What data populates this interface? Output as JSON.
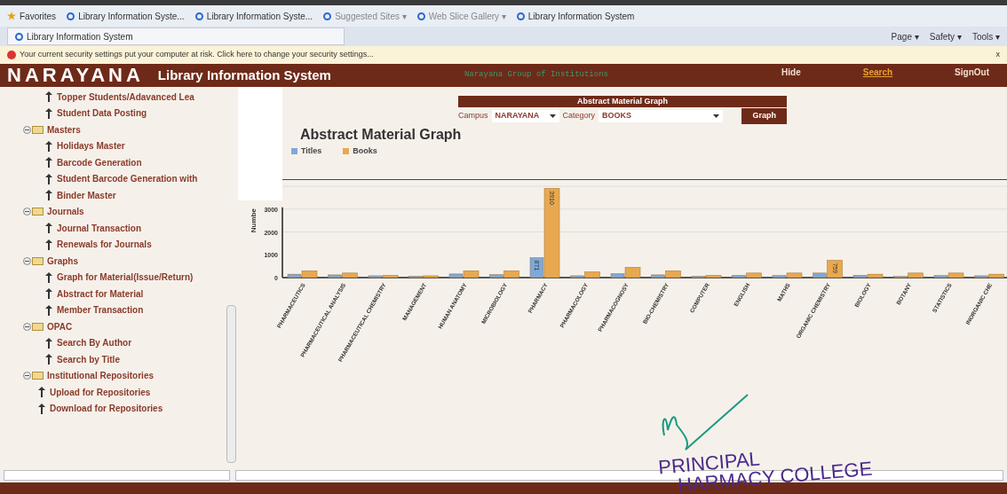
{
  "browser": {
    "favorites_label": "Favorites",
    "favorites": [
      {
        "label": "Library Information Syste...",
        "kind": "page"
      },
      {
        "label": "Library Information Syste...",
        "kind": "page"
      },
      {
        "label": "Suggested Sites ▾",
        "kind": "page"
      },
      {
        "label": "Web Slice Gallery ▾",
        "kind": "page"
      },
      {
        "label": "Library Information System",
        "kind": "page"
      }
    ],
    "tab": "Library Information System",
    "commands": [
      "Page ▾",
      "Safety ▾",
      "Tools ▾"
    ],
    "info_bar": "Your current security settings put your computer at risk. Click here to change your security settings...",
    "info_close": "x"
  },
  "header": {
    "logo": "NARAYANA",
    "title": "Library Information System",
    "group": "Narayana Group of Institutions",
    "links": [
      {
        "label": "Hide",
        "selected": false
      },
      {
        "label": "Search",
        "selected": true
      },
      {
        "label": "SignOut",
        "selected": false
      }
    ]
  },
  "sidebar": {
    "continued_items": [
      "Topper Students/Adavanced Lea",
      "Student Data Posting"
    ],
    "folders": [
      {
        "label": "Masters",
        "expanded": true,
        "children": [
          "Holidays Master",
          "Barcode Generation",
          "Student Barcode Generation with",
          "Binder Master"
        ]
      },
      {
        "label": "Journals",
        "expanded": true,
        "children": [
          "Journal Transaction",
          "Renewals for Journals"
        ]
      },
      {
        "label": "Graphs",
        "expanded": true,
        "children": [
          "Graph for Material(Issue/Return)",
          "Abstract for Material",
          "Member Transaction"
        ]
      },
      {
        "label": "OPAC",
        "expanded": true,
        "children": [
          "Search By Author",
          "Search by Title"
        ]
      },
      {
        "label": "Institutional Repositories",
        "expanded": true,
        "children": [
          "Upload for Repositories",
          "Download for Repositories"
        ]
      }
    ]
  },
  "form": {
    "title": "Abstract Material Graph",
    "campus_label": "Campus",
    "campus_value": "NARAYANA",
    "category_label": "Category",
    "category_value": "BOOKS",
    "button": "Graph"
  },
  "chart": {
    "title": "Abstract Material Graph",
    "chart_data": {
      "type": "bar",
      "ylabel": "Numbe",
      "categories": [
        "PHARMACEUTICS",
        "PHARMACEUTICAL ANALYSIS",
        "PHARMACEUTICAL CHEMISTRY",
        "MANAGEMENT",
        "HUMAN ANATOMY",
        "MICROBIOLOGY",
        "PHARMACY",
        "PHARMACOLOGY",
        "PHARMACOGNOSY",
        "BIO-CHEMISTRY",
        "COMPUTER",
        "ENGLISH",
        "MATHS",
        "ORGANIC CHEMISTRY",
        "BIOLOGY",
        "BOTANY",
        "STATISTICS",
        "INORGANIC CHE"
      ],
      "series": [
        {
          "name": "Titles",
          "color": "#7fa8d8",
          "values": [
            150,
            120,
            80,
            60,
            160,
            130,
            871,
            80,
            170,
            120,
            60,
            100,
            90,
            200,
            100,
            50,
            90,
            80
          ],
          "value_labels": [
            null,
            null,
            null,
            null,
            null,
            null,
            "871",
            null,
            null,
            null,
            null,
            null,
            null,
            null,
            null,
            null,
            null,
            null
          ]
        },
        {
          "name": "Books",
          "color": "#e8a850",
          "values": [
            300,
            200,
            100,
            80,
            300,
            300,
            3910,
            250,
            450,
            300,
            100,
            200,
            200,
            759,
            150,
            200,
            200,
            150
          ],
          "value_labels": [
            null,
            null,
            null,
            null,
            null,
            null,
            "3910",
            null,
            null,
            null,
            null,
            null,
            null,
            "759",
            null,
            null,
            null,
            null
          ]
        }
      ],
      "ylim": [
        0,
        4000
      ],
      "yticks": [
        0,
        1000,
        2000,
        3000
      ]
    }
  },
  "stamp": {
    "line_1": "PRINCIPAL",
    "line_2": "HARMACY COLLEGE"
  }
}
